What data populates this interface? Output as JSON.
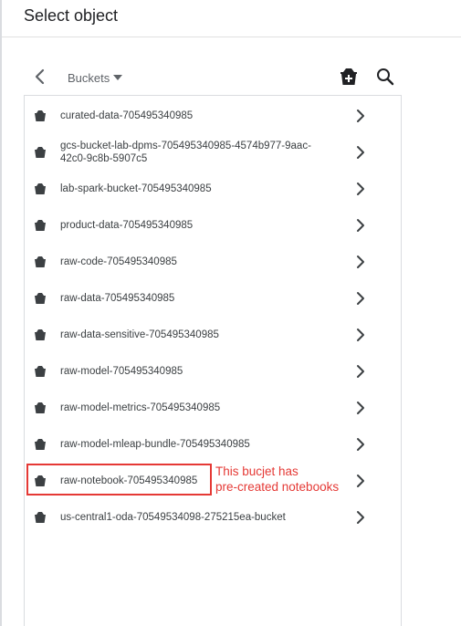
{
  "dialog": {
    "title": "Select object"
  },
  "toolbar": {
    "breadcrumb_label": "Buckets"
  },
  "buckets": [
    {
      "name": "curated-data-705495340985"
    },
    {
      "name": "gcs-bucket-lab-dpms-705495340985-4574b977-9aac-42c0-9c8b-5907c5"
    },
    {
      "name": "lab-spark-bucket-705495340985"
    },
    {
      "name": "product-data-705495340985"
    },
    {
      "name": "raw-code-705495340985"
    },
    {
      "name": "raw-data-705495340985"
    },
    {
      "name": "raw-data-sensitive-705495340985"
    },
    {
      "name": "raw-model-705495340985"
    },
    {
      "name": "raw-model-metrics-705495340985"
    },
    {
      "name": "raw-model-mleap-bundle-705495340985"
    },
    {
      "name": "raw-notebook-705495340985"
    },
    {
      "name": "us-central1-oda-70549534098-275215ea-bucket"
    }
  ],
  "annotation": {
    "line1": "This bucjet has",
    "line2": "pre-created notebooks",
    "color": "#e53935"
  },
  "icons": {
    "back": "arrow-left-icon",
    "breadcrumb_caret": "caret-down-icon",
    "new_bucket": "create-bucket-icon",
    "search": "search-icon",
    "bucket": "bucket-icon",
    "row_chevron": "chevron-right-icon"
  }
}
